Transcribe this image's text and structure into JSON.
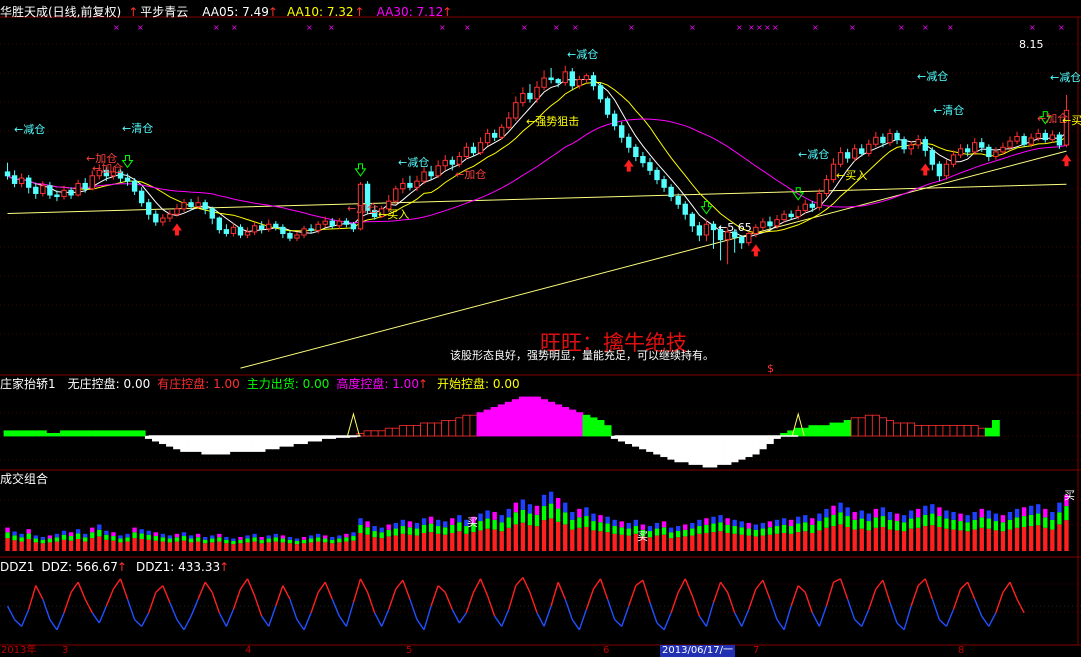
{
  "colors": {
    "bg": "#000000",
    "grid": "#800000",
    "up": "#ff3030",
    "down": "#54ffff",
    "ma5": "#ffffff",
    "ma10": "#ffff00",
    "ma30": "#ff00ff",
    "trend": "#ffff80",
    "label": "#54ffff",
    "blue": "#2040ff",
    "green": "#00ff00",
    "magenta": "#ff00ff",
    "redline": "#ff2020",
    "blueline": "#2050ff"
  },
  "price_panel": {
    "stock": "华胜天成(日线,前复权)",
    "arrow_up": "↑",
    "formula": "平步青云",
    "ma5": "AA05: 7.49",
    "ma10": "AA10: 7.32",
    "ma30": "AA30: 7.12",
    "high_label": "8.15",
    "low_label": "←5.65",
    "slogan": "旺旺：擒牛绝技",
    "comment": "该股形态良好，强势明显，量能充足，可以继续持有。",
    "dollar": "$",
    "signals": {
      "reduce": "←减仓",
      "clear": "←清仓",
      "add": "←加仓",
      "buy": "←买入",
      "strong": "←强势狙击"
    }
  },
  "ind1": {
    "name": "庄家抬轿1",
    "free": "无庄控盘: 0.00",
    "dealer": "有庄控盘: 1.00",
    "main": "主力出货: 0.00",
    "high": "高度控盘: 1.00",
    "start": "开始控盘: 0.00",
    "colors": {
      "free": "#ffffff",
      "dealer": "#ff3030",
      "main": "#00ff00",
      "high": "#ff00ff",
      "start": "#ffff00"
    }
  },
  "ind2": {
    "name": "成交组合",
    "buy": "买"
  },
  "ind3": {
    "name": "DDZ1",
    "ddz": "DDZ: 566.67",
    "ddz1": "DDZ1: 433.33"
  },
  "axis": {
    "year": "2013年",
    "m3": "3",
    "m4": "4",
    "m5": "5",
    "m6": "6",
    "cursor": "2013/06/17/一",
    "m7": "7",
    "m8": "8"
  },
  "chart_data": {
    "type": "candlestick",
    "ma_periods": [
      5,
      10,
      30
    ],
    "ohlc": [
      [
        7.6,
        7.55,
        7.72,
        7.5
      ],
      [
        7.55,
        7.45,
        7.62,
        7.4
      ],
      [
        7.45,
        7.52,
        7.58,
        7.4
      ],
      [
        7.52,
        7.4,
        7.56,
        7.32
      ],
      [
        7.4,
        7.32,
        7.46,
        7.25
      ],
      [
        7.32,
        7.42,
        7.48,
        7.28
      ],
      [
        7.42,
        7.3,
        7.47,
        7.25
      ],
      [
        7.3,
        7.28,
        7.36,
        7.22
      ],
      [
        7.28,
        7.36,
        7.42,
        7.24
      ],
      [
        7.36,
        7.3,
        7.4,
        7.25
      ],
      [
        7.3,
        7.45,
        7.5,
        7.28
      ],
      [
        7.45,
        7.38,
        7.52,
        7.33
      ],
      [
        7.38,
        7.55,
        7.62,
        7.36
      ],
      [
        7.55,
        7.62,
        7.7,
        7.5
      ],
      [
        7.62,
        7.55,
        7.66,
        7.48
      ],
      [
        7.55,
        7.6,
        7.65,
        7.5
      ],
      [
        7.6,
        7.52,
        7.64,
        7.46
      ],
      [
        7.52,
        7.48,
        7.58,
        7.42
      ],
      [
        7.48,
        7.35,
        7.52,
        7.3
      ],
      [
        7.35,
        7.2,
        7.4,
        7.15
      ],
      [
        7.2,
        7.05,
        7.25,
        6.98
      ],
      [
        7.05,
        6.95,
        7.1,
        6.9
      ],
      [
        6.95,
        7.0,
        7.05,
        6.9
      ],
      [
        7.0,
        7.05,
        7.1,
        6.95
      ],
      [
        7.05,
        7.12,
        7.18,
        7.02
      ],
      [
        7.12,
        7.2,
        7.25,
        7.08
      ],
      [
        7.2,
        7.15,
        7.25,
        7.1
      ],
      [
        7.15,
        7.2,
        7.28,
        7.12
      ],
      [
        7.2,
        7.12,
        7.24,
        7.05
      ],
      [
        7.12,
        7.0,
        7.15,
        6.92
      ],
      [
        7.0,
        6.85,
        7.02,
        6.8
      ],
      [
        6.85,
        6.8,
        6.92,
        6.76
      ],
      [
        6.8,
        6.88,
        6.93,
        6.76
      ],
      [
        6.88,
        6.78,
        6.92,
        6.74
      ],
      [
        6.78,
        6.82,
        6.88,
        6.74
      ],
      [
        6.82,
        6.9,
        6.95,
        6.78
      ],
      [
        6.9,
        6.86,
        6.96,
        6.8
      ],
      [
        6.86,
        6.92,
        6.98,
        6.82
      ],
      [
        6.92,
        6.88,
        6.96,
        6.84
      ],
      [
        6.88,
        6.8,
        6.92,
        6.74
      ],
      [
        6.8,
        6.74,
        6.84,
        6.7
      ],
      [
        6.74,
        6.78,
        6.82,
        6.7
      ],
      [
        6.78,
        6.86,
        6.9,
        6.74
      ],
      [
        6.86,
        6.84,
        6.92,
        6.8
      ],
      [
        6.84,
        6.92,
        6.96,
        6.8
      ],
      [
        6.92,
        6.96,
        7.02,
        6.88
      ],
      [
        6.96,
        6.9,
        7.0,
        6.86
      ],
      [
        6.9,
        6.96,
        7.0,
        6.86
      ],
      [
        6.96,
        6.92,
        7.0,
        6.88
      ],
      [
        6.92,
        6.86,
        6.95,
        6.82
      ],
      [
        6.86,
        7.44,
        7.47,
        6.84
      ],
      [
        7.44,
        7.1,
        7.48,
        7.06
      ],
      [
        7.1,
        7.02,
        7.16,
        6.98
      ],
      [
        7.02,
        7.12,
        7.16,
        7.0
      ],
      [
        7.12,
        7.22,
        7.3,
        7.08
      ],
      [
        7.22,
        7.38,
        7.42,
        7.18
      ],
      [
        7.38,
        7.45,
        7.52,
        7.32
      ],
      [
        7.45,
        7.4,
        7.55,
        7.36
      ],
      [
        7.4,
        7.48,
        7.55,
        7.35
      ],
      [
        7.48,
        7.6,
        7.66,
        7.44
      ],
      [
        7.6,
        7.55,
        7.68,
        7.5
      ],
      [
        7.55,
        7.68,
        7.75,
        7.52
      ],
      [
        7.68,
        7.75,
        7.82,
        7.62
      ],
      [
        7.75,
        7.7,
        7.8,
        7.62
      ],
      [
        7.7,
        7.8,
        7.86,
        7.66
      ],
      [
        7.8,
        7.92,
        7.98,
        7.76
      ],
      [
        7.92,
        7.85,
        7.98,
        7.8
      ],
      [
        7.85,
        7.98,
        8.05,
        7.82
      ],
      [
        7.98,
        8.1,
        8.16,
        7.94
      ],
      [
        8.1,
        8.05,
        8.15,
        8.0
      ],
      [
        8.05,
        8.18,
        8.22,
        8.02
      ],
      [
        8.18,
        8.3,
        8.38,
        8.15
      ],
      [
        8.3,
        8.5,
        8.58,
        8.26
      ],
      [
        8.5,
        8.62,
        8.7,
        8.45
      ],
      [
        8.62,
        8.55,
        8.74,
        8.5
      ],
      [
        8.55,
        8.7,
        8.78,
        8.5
      ],
      [
        8.7,
        8.82,
        8.92,
        8.66
      ],
      [
        8.82,
        8.8,
        8.95,
        8.75
      ],
      [
        8.8,
        8.76,
        8.82,
        8.7
      ],
      [
        8.76,
        8.9,
        8.98,
        8.72
      ],
      [
        8.9,
        8.72,
        8.95,
        8.66
      ],
      [
        8.72,
        8.8,
        8.85,
        8.68
      ],
      [
        8.8,
        8.85,
        8.88,
        8.75
      ],
      [
        8.85,
        8.72,
        8.9,
        8.66
      ],
      [
        8.72,
        8.55,
        8.76,
        8.5
      ],
      [
        8.55,
        8.35,
        8.58,
        8.3
      ],
      [
        8.35,
        8.2,
        8.4,
        8.14
      ],
      [
        8.2,
        8.05,
        8.25,
        7.98
      ],
      [
        8.05,
        7.92,
        8.1,
        7.85
      ],
      [
        7.92,
        7.8,
        7.96,
        7.74
      ],
      [
        7.8,
        7.72,
        7.86,
        7.66
      ],
      [
        7.72,
        7.62,
        7.78,
        7.56
      ],
      [
        7.62,
        7.5,
        7.66,
        7.44
      ],
      [
        7.5,
        7.4,
        7.55,
        7.34
      ],
      [
        7.4,
        7.28,
        7.44,
        7.22
      ],
      [
        7.28,
        7.18,
        7.32,
        7.12
      ],
      [
        7.18,
        7.05,
        7.22,
        6.98
      ],
      [
        7.05,
        6.9,
        7.08,
        6.82
      ],
      [
        6.9,
        6.78,
        6.95,
        6.7
      ],
      [
        6.78,
        6.92,
        6.98,
        6.7
      ],
      [
        6.92,
        6.85,
        6.96,
        6.6
      ],
      [
        6.85,
        6.72,
        6.9,
        6.45
      ],
      [
        6.72,
        6.82,
        6.88,
        6.4
      ],
      [
        6.82,
        6.75,
        6.86,
        6.55
      ],
      [
        6.75,
        6.68,
        6.78,
        6.6
      ],
      [
        6.68,
        6.8,
        6.84,
        6.64
      ],
      [
        6.8,
        6.88,
        6.92,
        6.75
      ],
      [
        6.88,
        6.95,
        7.0,
        6.84
      ],
      [
        6.95,
        6.9,
        7.02,
        6.86
      ],
      [
        6.9,
        6.98,
        7.04,
        6.86
      ],
      [
        6.98,
        7.05,
        7.1,
        6.94
      ],
      [
        7.05,
        7.02,
        7.1,
        6.98
      ],
      [
        7.02,
        7.1,
        7.16,
        6.98
      ],
      [
        7.1,
        7.18,
        7.24,
        7.06
      ],
      [
        7.18,
        7.14,
        7.22,
        7.08
      ],
      [
        7.14,
        7.32,
        7.38,
        7.1
      ],
      [
        7.32,
        7.5,
        7.56,
        7.28
      ],
      [
        7.5,
        7.7,
        7.78,
        7.46
      ],
      [
        7.7,
        7.85,
        7.92,
        7.66
      ],
      [
        7.85,
        7.78,
        7.9,
        7.72
      ],
      [
        7.78,
        7.9,
        7.96,
        7.74
      ],
      [
        7.9,
        7.84,
        7.96,
        7.8
      ],
      [
        7.84,
        7.96,
        8.02,
        7.8
      ],
      [
        7.96,
        8.05,
        8.12,
        7.92
      ],
      [
        8.05,
        7.98,
        8.1,
        7.92
      ],
      [
        7.98,
        8.1,
        8.16,
        7.94
      ],
      [
        8.1,
        8.02,
        8.14,
        7.96
      ],
      [
        8.02,
        7.9,
        8.06,
        7.84
      ],
      [
        7.9,
        7.95,
        8.0,
        7.82
      ],
      [
        7.95,
        8.02,
        8.08,
        7.9
      ],
      [
        8.02,
        7.88,
        8.06,
        7.8
      ],
      [
        7.88,
        7.7,
        7.92,
        7.62
      ],
      [
        7.7,
        7.55,
        7.74,
        7.48
      ],
      [
        7.55,
        7.7,
        7.76,
        7.5
      ],
      [
        7.7,
        7.82,
        7.88,
        7.66
      ],
      [
        7.82,
        7.9,
        7.96,
        7.78
      ],
      [
        7.9,
        7.86,
        7.96,
        7.8
      ],
      [
        7.86,
        7.98,
        8.04,
        7.82
      ],
      [
        7.98,
        7.92,
        8.04,
        7.86
      ],
      [
        7.92,
        7.8,
        7.96,
        7.74
      ],
      [
        7.8,
        7.86,
        7.92,
        7.76
      ],
      [
        7.86,
        7.92,
        7.98,
        7.82
      ],
      [
        7.92,
        8.0,
        8.06,
        7.88
      ],
      [
        8.0,
        8.06,
        8.12,
        7.96
      ],
      [
        8.06,
        7.96,
        8.1,
        7.92
      ],
      [
        7.96,
        8.04,
        8.1,
        7.92
      ],
      [
        8.04,
        8.1,
        8.16,
        8.0
      ],
      [
        8.1,
        8.02,
        8.15,
        7.98
      ],
      [
        8.02,
        8.08,
        8.14,
        7.98
      ],
      [
        8.08,
        7.95,
        8.12,
        7.9
      ],
      [
        7.95,
        8.4,
        8.6,
        7.92
      ]
    ],
    "ind1_values": [
      1,
      1,
      1,
      1,
      1,
      1,
      0.5,
      0.5,
      1,
      1,
      1,
      1,
      1,
      1,
      1,
      1,
      1,
      1,
      1,
      1,
      -0.5,
      -1,
      -1.5,
      -2,
      -2.5,
      -3,
      -3,
      -3,
      -3.5,
      -3.5,
      -3.5,
      -3.5,
      -3,
      -3,
      -3,
      -3,
      -3,
      -2.5,
      -2.5,
      -2,
      -2,
      -1.5,
      -1.5,
      -1,
      -1,
      -0.5,
      -0.5,
      -0.3,
      -0.3,
      -0.2,
      0.5,
      1,
      1,
      1,
      1.5,
      1.5,
      2,
      2,
      2,
      2.5,
      2.5,
      2.5,
      3,
      3,
      3.5,
      4,
      4,
      4.5,
      5,
      5.5,
      6,
      6.5,
      7,
      7.5,
      7.5,
      7.5,
      7,
      6.5,
      6,
      5.5,
      5,
      4.5,
      4,
      3.5,
      3,
      2,
      -0.5,
      -1,
      -1.5,
      -2,
      -2.5,
      -3,
      -3.5,
      -4,
      -4.5,
      -5,
      -5,
      -5.5,
      -5.5,
      -6,
      -6,
      -5.5,
      -5.5,
      -5,
      -4.5,
      -4,
      -3.5,
      -2.5,
      -1.5,
      -0.5,
      0.5,
      1,
      1.5,
      1.5,
      2,
      2,
      2,
      2.5,
      2.5,
      3,
      3.5,
      3.5,
      4,
      4,
      3.5,
      3,
      2.5,
      2.5,
      2.5,
      2,
      2,
      2,
      2,
      2,
      2,
      2,
      2,
      2,
      1.5,
      1.5,
      3
    ],
    "volume": [
      30,
      25,
      22,
      28,
      20,
      18,
      20,
      22,
      26,
      24,
      28,
      22,
      30,
      34,
      26,
      24,
      20,
      22,
      30,
      28,
      26,
      24,
      22,
      20,
      22,
      24,
      20,
      22,
      18,
      20,
      22,
      18,
      16,
      18,
      20,
      22,
      18,
      20,
      22,
      20,
      18,
      16,
      18,
      20,
      22,
      20,
      18,
      20,
      22,
      24,
      42,
      38,
      32,
      30,
      34,
      36,
      40,
      38,
      36,
      42,
      44,
      40,
      38,
      42,
      46,
      40,
      44,
      48,
      52,
      50,
      46,
      54,
      62,
      66,
      60,
      58,
      72,
      76,
      68,
      62,
      50,
      54,
      56,
      48,
      46,
      44,
      40,
      38,
      36,
      40,
      34,
      32,
      36,
      38,
      30,
      32,
      34,
      36,
      40,
      42,
      44,
      46,
      42,
      40,
      38,
      36,
      34,
      36,
      38,
      40,
      42,
      40,
      44,
      46,
      42,
      48,
      54,
      58,
      62,
      56,
      50,
      52,
      48,
      54,
      56,
      50,
      48,
      46,
      52,
      54,
      58,
      60,
      56,
      52,
      50,
      48,
      46,
      50,
      54,
      52,
      48,
      46,
      50,
      54,
      56,
      58,
      60,
      54,
      50,
      62,
      72
    ],
    "ddz": [
      50,
      30,
      20,
      45,
      80,
      60,
      30,
      15,
      40,
      70,
      85,
      60,
      40,
      25,
      50,
      75,
      90,
      60,
      30,
      20,
      40,
      70,
      80,
      55,
      30,
      15,
      35,
      60,
      85,
      70,
      40,
      20,
      45,
      75,
      90,
      65,
      35,
      20,
      50,
      80,
      60,
      30,
      15,
      40,
      70,
      85,
      60,
      35,
      20,
      55,
      90,
      70,
      40,
      20,
      45,
      75,
      88,
      60,
      30,
      15,
      50,
      80,
      70,
      45,
      25,
      40,
      70,
      90,
      65,
      35,
      20,
      45,
      80,
      92,
      70,
      40,
      20,
      50,
      85,
      60,
      30,
      15,
      45,
      75,
      90,
      60,
      30,
      20,
      50,
      80,
      88,
      55,
      25,
      15,
      40,
      70,
      90,
      65,
      35,
      20,
      55,
      85,
      70,
      40,
      20,
      45,
      75,
      88,
      60,
      30,
      15,
      50,
      80,
      70,
      40,
      20,
      50,
      85,
      90,
      60,
      30,
      20,
      45,
      75,
      88,
      55,
      25,
      15,
      50,
      80,
      90,
      60,
      30,
      20,
      45,
      75,
      85,
      60,
      35,
      20,
      40,
      70,
      85,
      60,
      40
    ],
    "x_labels": [
      "2013年",
      "3",
      "4",
      "5",
      "6",
      "2013/06/17/一",
      "7",
      "8"
    ]
  }
}
